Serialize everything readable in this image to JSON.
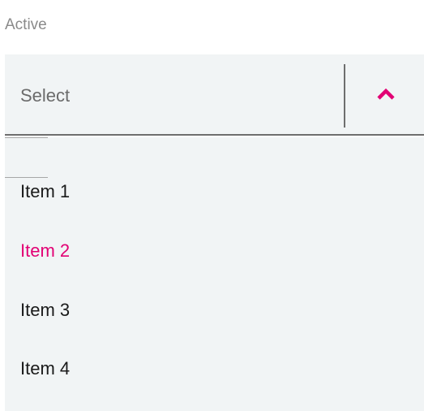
{
  "label": "Active",
  "select": {
    "value": "Select",
    "icon": "chevron-up-icon",
    "accent_color": "#e20074"
  },
  "menu": {
    "items": [
      {
        "label": "Item 1",
        "selected": false
      },
      {
        "label": "Item 2",
        "selected": true
      },
      {
        "label": "Item 3",
        "selected": false
      },
      {
        "label": "Item 4",
        "selected": false
      }
    ]
  }
}
